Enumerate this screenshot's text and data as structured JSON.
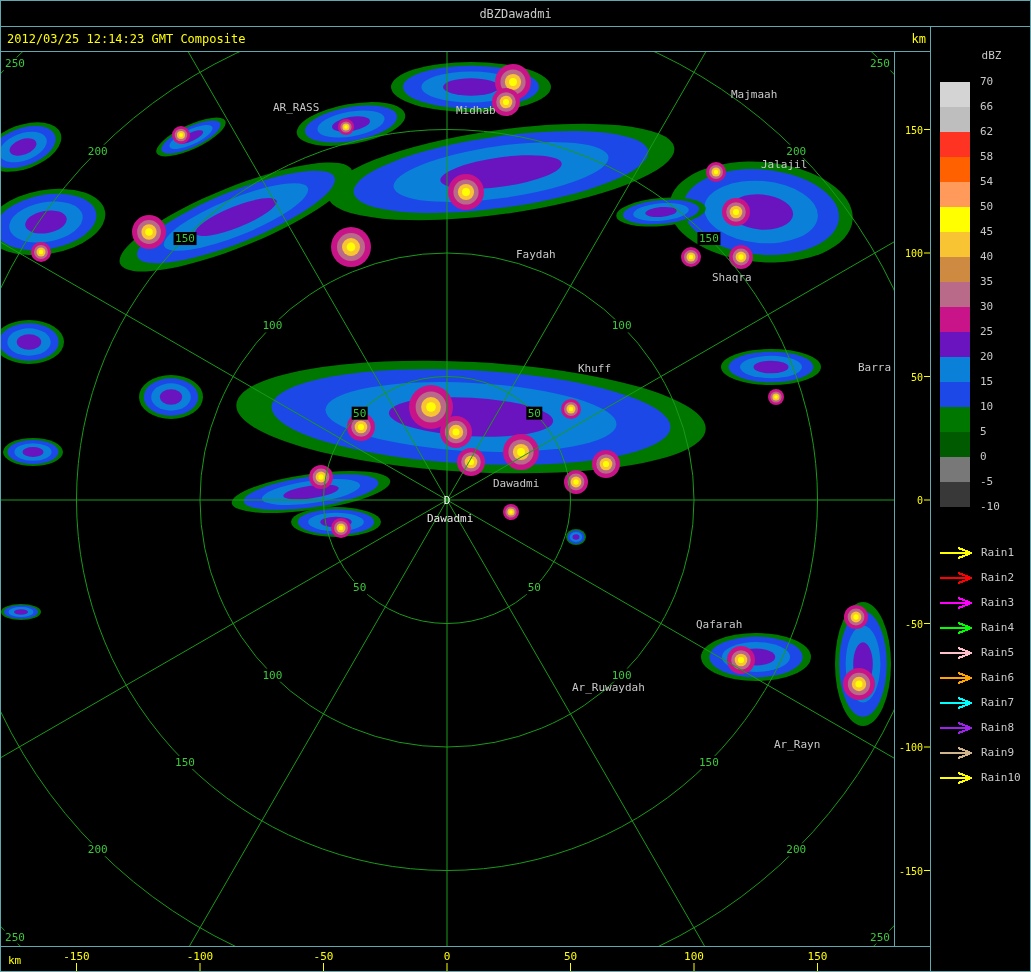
{
  "window": {
    "title": "dBZDawadmi"
  },
  "header": {
    "timestamp": "2012/03/25 12:14:23 GMT Composite"
  },
  "radar": {
    "station_marker": "D",
    "places": [
      {
        "name": "AR_RASS"
      },
      {
        "name": "Midhab"
      },
      {
        "name": "Majmaah"
      },
      {
        "name": "Jalajil"
      },
      {
        "name": "Faydah"
      },
      {
        "name": "Shaqra"
      },
      {
        "name": "Khuff"
      },
      {
        "name": "Barra"
      },
      {
        "name": "Dawadmi"
      },
      {
        "name": "Dawadmi"
      },
      {
        "name": "Qafarah"
      },
      {
        "name": "Ar_Ruwaydah"
      },
      {
        "name": "Ar_Rayn"
      }
    ],
    "rings": [
      {
        "labels": [
          "50",
          "50",
          "50",
          "50"
        ]
      },
      {
        "labels": [
          "100",
          "100",
          "100",
          "100"
        ]
      },
      {
        "labels": [
          "150",
          "150",
          "150",
          "150"
        ]
      },
      {
        "labels": [
          "200",
          "200",
          "200",
          "200"
        ]
      },
      {
        "labels": [
          "250",
          "250",
          "250",
          "250"
        ]
      }
    ]
  },
  "y_axis": {
    "unit": "km",
    "ticks": [
      "150",
      "100",
      "50",
      "0",
      "-50",
      "-100",
      "-150"
    ]
  },
  "x_axis": {
    "unit": "km",
    "ticks": [
      "-150",
      "-100",
      "-50",
      "0",
      "50",
      "100",
      "150"
    ]
  },
  "legend": {
    "title": "dBZ",
    "labels": [
      "70",
      "66",
      "62",
      "58",
      "54",
      "50",
      "45",
      "40",
      "35",
      "30",
      "25",
      "20",
      "15",
      "10",
      "5",
      "0",
      "-5",
      "-10"
    ],
    "swatches": [
      {
        "color": "#d4d4d4"
      },
      {
        "color": "#bebebe"
      },
      {
        "color": "#ff3322"
      },
      {
        "color": "#ff6000"
      },
      {
        "color": "#ff9a5a"
      },
      {
        "color": "#ffff00"
      },
      {
        "color": "#f8c434"
      },
      {
        "color": "#cd8a40"
      },
      {
        "color": "#b86a88"
      },
      {
        "color": "#c81488"
      },
      {
        "color": "#6a14c0"
      },
      {
        "color": "#0a80d8"
      },
      {
        "color": "#1c48e8"
      },
      {
        "color": "#007800"
      },
      {
        "color": "#005a00"
      },
      {
        "color": "#787878"
      },
      {
        "color": "#383838"
      }
    ],
    "tracks": [
      {
        "label": "Rain1",
        "color": "#ffff00"
      },
      {
        "label": "Rain2",
        "color": "#ff0000"
      },
      {
        "label": "Rain3",
        "color": "#ff00ff"
      },
      {
        "label": "Rain4",
        "color": "#00ff00"
      },
      {
        "label": "Rain5",
        "color": "#ffc0cb"
      },
      {
        "label": "Rain6",
        "color": "#ffa500"
      },
      {
        "label": "Rain7",
        "color": "#00ffff"
      },
      {
        "label": "Rain8",
        "color": "#a020f0"
      },
      {
        "label": "Rain9",
        "color": "#d2b48c"
      },
      {
        "label": "Rain10",
        "color": "#ffff00"
      }
    ]
  }
}
